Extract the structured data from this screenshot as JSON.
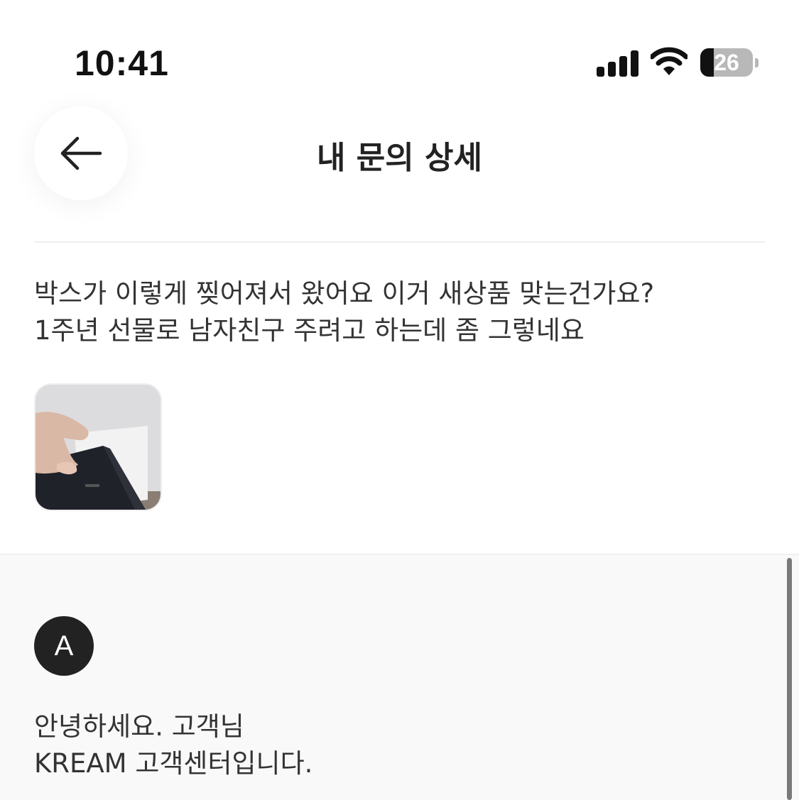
{
  "status_bar": {
    "time": "10:41",
    "battery_level": "26",
    "battery_fraction": 0.26,
    "signal_icon": "cellular-signal-icon",
    "wifi_icon": "wifi-icon",
    "battery_icon": "battery-icon"
  },
  "header": {
    "title": "내 문의 상세",
    "back_icon": "arrow-left-icon"
  },
  "inquiry": {
    "lines": [
      "박스가 이렇게 찢어져서 왔어요 이거 새상품 맞는건가요?",
      "1주년 선물로 남자친구 주려고 하는데 좀 그렇네요"
    ],
    "attachment": "photo-thumbnail"
  },
  "answer": {
    "avatar_initial": "A",
    "lines": [
      "안녕하세요. 고객님",
      "KREAM 고객센터입니다."
    ]
  },
  "colors": {
    "text_primary": "#222222",
    "answer_background": "#f9f9f9",
    "avatar_background": "#222222"
  }
}
